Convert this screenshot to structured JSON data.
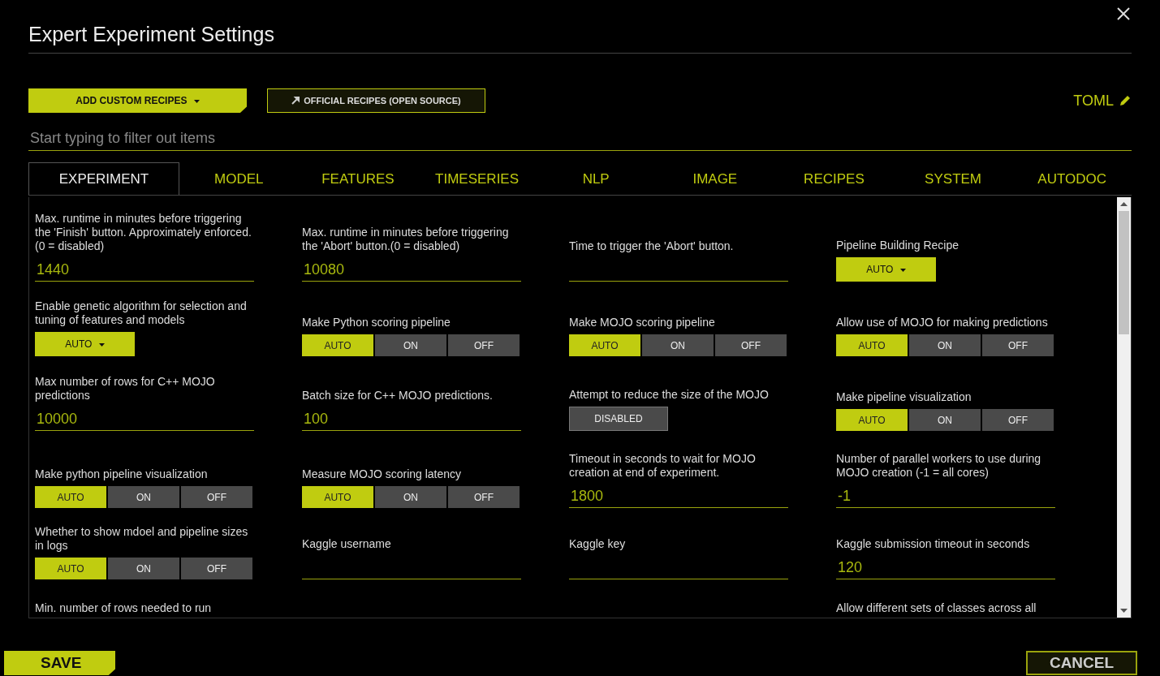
{
  "dialog": {
    "title": "Expert Experiment Settings"
  },
  "toolbar": {
    "add_recipes": "ADD CUSTOM RECIPES",
    "official_recipes": "OFFICIAL RECIPES (OPEN SOURCE)",
    "toml": "TOML"
  },
  "filter": {
    "placeholder": "Start typing to filter out items"
  },
  "tabs": [
    {
      "label": "EXPERIMENT",
      "selected": true
    },
    {
      "label": "MODEL",
      "selected": false
    },
    {
      "label": "FEATURES",
      "selected": false
    },
    {
      "label": "TIMESERIES",
      "selected": false
    },
    {
      "label": "NLP",
      "selected": false
    },
    {
      "label": "IMAGE",
      "selected": false
    },
    {
      "label": "RECIPES",
      "selected": false
    },
    {
      "label": "SYSTEM",
      "selected": false
    },
    {
      "label": "AUTODOC",
      "selected": false
    }
  ],
  "settings": [
    {
      "kind": "text",
      "label": "Max. runtime in minutes before triggering the 'Finish' button. Approximately enforced. (0 = disabled)",
      "value": "1440"
    },
    {
      "kind": "text",
      "label": "Max. runtime in minutes before triggering the 'Abort' button.(0 = disabled)",
      "value": "10080"
    },
    {
      "kind": "text",
      "label": "Time to trigger the 'Abort' button."
    },
    {
      "kind": "dropdown",
      "label": "Pipeline Building Recipe",
      "value": "AUTO"
    },
    {
      "kind": "dropdown",
      "label": "Enable genetic algorithm for selection and tuning of features and models",
      "value": "AUTO"
    },
    {
      "kind": "tristate",
      "label": "Make Python scoring pipeline",
      "options": [
        {
          "label": "AUTO",
          "selected": true
        },
        {
          "label": "ON",
          "selected": false
        },
        {
          "label": "OFF",
          "selected": false
        }
      ]
    },
    {
      "kind": "tristate",
      "label": "Make MOJO scoring pipeline",
      "options": [
        {
          "label": "AUTO",
          "selected": true
        },
        {
          "label": "ON",
          "selected": false
        },
        {
          "label": "OFF",
          "selected": false
        }
      ]
    },
    {
      "kind": "tristate",
      "label": "Allow use of MOJO for making predictions",
      "options": [
        {
          "label": "AUTO",
          "selected": true
        },
        {
          "label": "ON",
          "selected": false
        },
        {
          "label": "OFF",
          "selected": false
        }
      ]
    },
    {
      "kind": "text",
      "label": "Max number of rows for C++ MOJO predictions",
      "value": "10000"
    },
    {
      "kind": "text",
      "label": "Batch size for C++ MOJO predictions.",
      "value": "100"
    },
    {
      "kind": "toggle",
      "label": "Attempt to reduce the size of the MOJO",
      "value": "DISABLED"
    },
    {
      "kind": "tristate",
      "label": "Make pipeline visualization",
      "options": [
        {
          "label": "AUTO",
          "selected": true
        },
        {
          "label": "ON",
          "selected": false
        },
        {
          "label": "OFF",
          "selected": false
        }
      ]
    },
    {
      "kind": "tristate",
      "label": "Make python pipeline visualization",
      "options": [
        {
          "label": "AUTO",
          "selected": true
        },
        {
          "label": "ON",
          "selected": false
        },
        {
          "label": "OFF",
          "selected": false
        }
      ]
    },
    {
      "kind": "tristate",
      "label": "Measure MOJO scoring latency",
      "options": [
        {
          "label": "AUTO",
          "selected": true
        },
        {
          "label": "ON",
          "selected": false
        },
        {
          "label": "OFF",
          "selected": false
        }
      ]
    },
    {
      "kind": "text",
      "label": "Timeout in seconds to wait for MOJO creation at end of experiment.",
      "value": "1800"
    },
    {
      "kind": "text",
      "label": "Number of parallel workers to use during MOJO creation (-1 = all cores)",
      "value": "-1"
    },
    {
      "kind": "tristate",
      "label": "Whether to show mdoel and pipeline sizes in logs",
      "options": [
        {
          "label": "AUTO",
          "selected": true
        },
        {
          "label": "ON",
          "selected": false
        },
        {
          "label": "OFF",
          "selected": false
        }
      ]
    },
    {
      "kind": "text",
      "label": "Kaggle username"
    },
    {
      "kind": "text",
      "label": "Kaggle key"
    },
    {
      "kind": "text",
      "label": "Kaggle submission timeout in seconds",
      "value": "120"
    },
    {
      "kind": "cut",
      "label": "Min. number of rows needed to run"
    },
    {
      "kind": "cut"
    },
    {
      "kind": "cut"
    },
    {
      "kind": "cut",
      "label": "Allow different sets of classes across all"
    }
  ],
  "footer": {
    "save": "SAVE",
    "cancel": "CANCEL"
  }
}
